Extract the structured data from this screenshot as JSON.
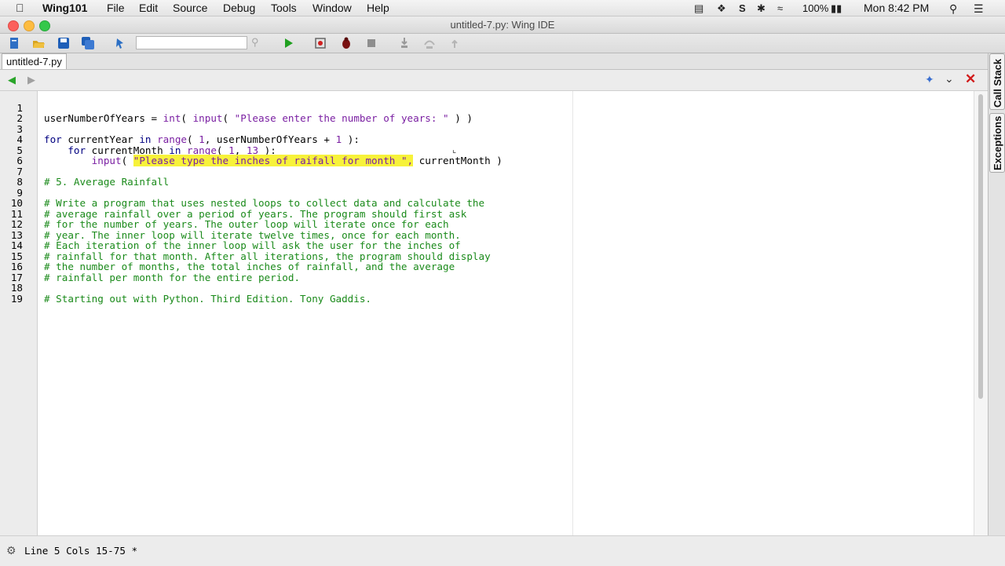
{
  "menubar": {
    "app_name": "Wing101",
    "items": [
      "File",
      "Edit",
      "Source",
      "Debug",
      "Tools",
      "Window",
      "Help"
    ],
    "battery": "100%",
    "clock": "Mon 8:42 PM"
  },
  "window": {
    "title": "untitled-7.py: Wing IDE"
  },
  "editor": {
    "tab_label": "untitled-7.py",
    "line_numbers": [
      "1",
      "2",
      "3",
      "4",
      "5",
      "6",
      "7",
      "8",
      "9",
      "10",
      "11",
      "12",
      "13",
      "14",
      "15",
      "16",
      "17",
      "18",
      "19"
    ],
    "code": {
      "l1_var": "userNumberOfYears = ",
      "l1_int": "int",
      "l1_p1": "( ",
      "l1_input": "input",
      "l1_p2": "( ",
      "l1_str": "\"Please enter the number of years: \"",
      "l1_end": " ) )",
      "l3_for": "for",
      "l3_a": " currentYear ",
      "l3_in": "in",
      "l3_range": " range",
      "l3_b": "( ",
      "l3_n1": "1",
      "l3_c": ", userNumberOfYears + ",
      "l3_n2": "1",
      "l3_d": " ):",
      "l4_indent": "    ",
      "l4_for": "for",
      "l4_a": " currentMonth ",
      "l4_in": "in",
      "l4_range": " range",
      "l4_b": "( ",
      "l4_n1": "1",
      "l4_c": ", ",
      "l4_n2": "13",
      "l4_d": " ):",
      "l5_indent": "        ",
      "l5_input": "input",
      "l5_p": "( ",
      "l5_sel": "\"Please type the inches of raifall for month \",",
      "l5_after": " currentMonth",
      "l5_end": " )",
      "l7": "# 5. Average Rainfall",
      "l9": "# Write a program that uses nested loops to collect data and calculate the",
      "l10": "# average rainfall over a period of years. The program should first ask",
      "l11": "# for the number of years. The outer loop will iterate once for each",
      "l12": "# year. The inner loop will iterate twelve times, once for each month.",
      "l13": "# Each iteration of the inner loop will ask the user for the inches of",
      "l14": "# rainfall for that month. After all iterations, the program should display",
      "l15": "# the number of months, the total inches of rainfall, and the average",
      "l16": "# rainfall per month for the entire period.",
      "l18": "# Starting out with Python. Third Edition. Tony Gaddis."
    }
  },
  "side_tabs": {
    "call_stack": "Call Stack",
    "exceptions": "Exceptions"
  },
  "status": {
    "text": "Line 5 Cols 15-75 *"
  }
}
